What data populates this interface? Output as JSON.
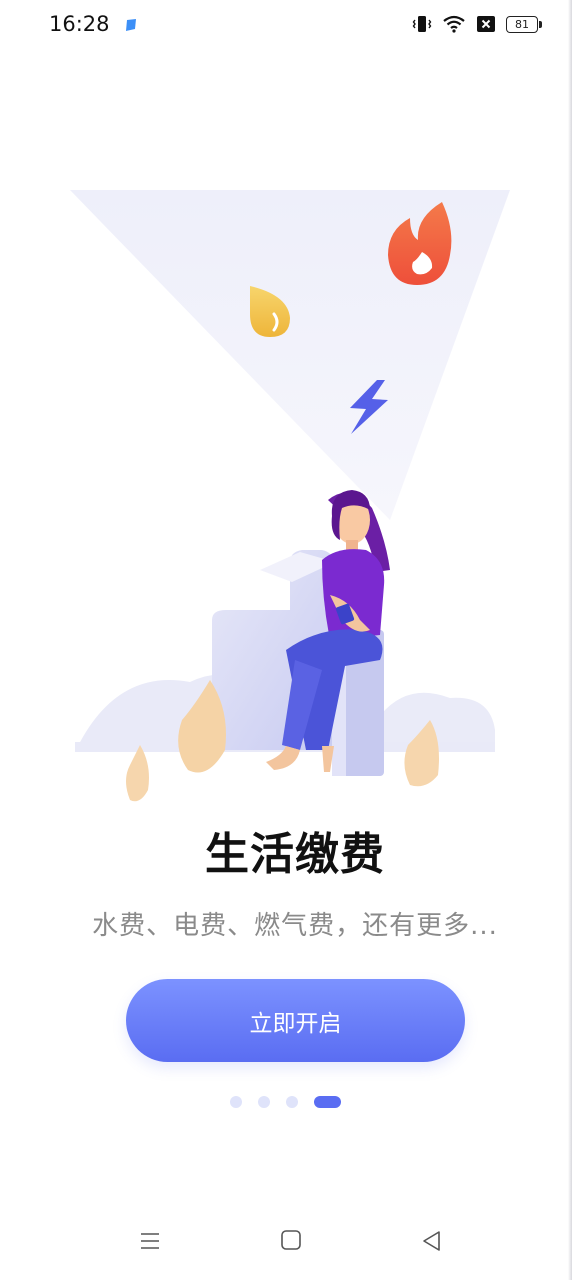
{
  "status_bar": {
    "time": "16:28",
    "battery": "81"
  },
  "onboarding": {
    "title": "生活缴费",
    "subtitle": "水费、电费、燃气费，还有更多...",
    "start_button_label": "立即开启",
    "page_count": 4,
    "active_page": 4
  },
  "colors": {
    "accent": "#5a6df2",
    "inactive_dot": "#dfe3fa",
    "flame": "#f2643f",
    "water_drop": "#f3c74c",
    "bolt": "#5560e8"
  }
}
